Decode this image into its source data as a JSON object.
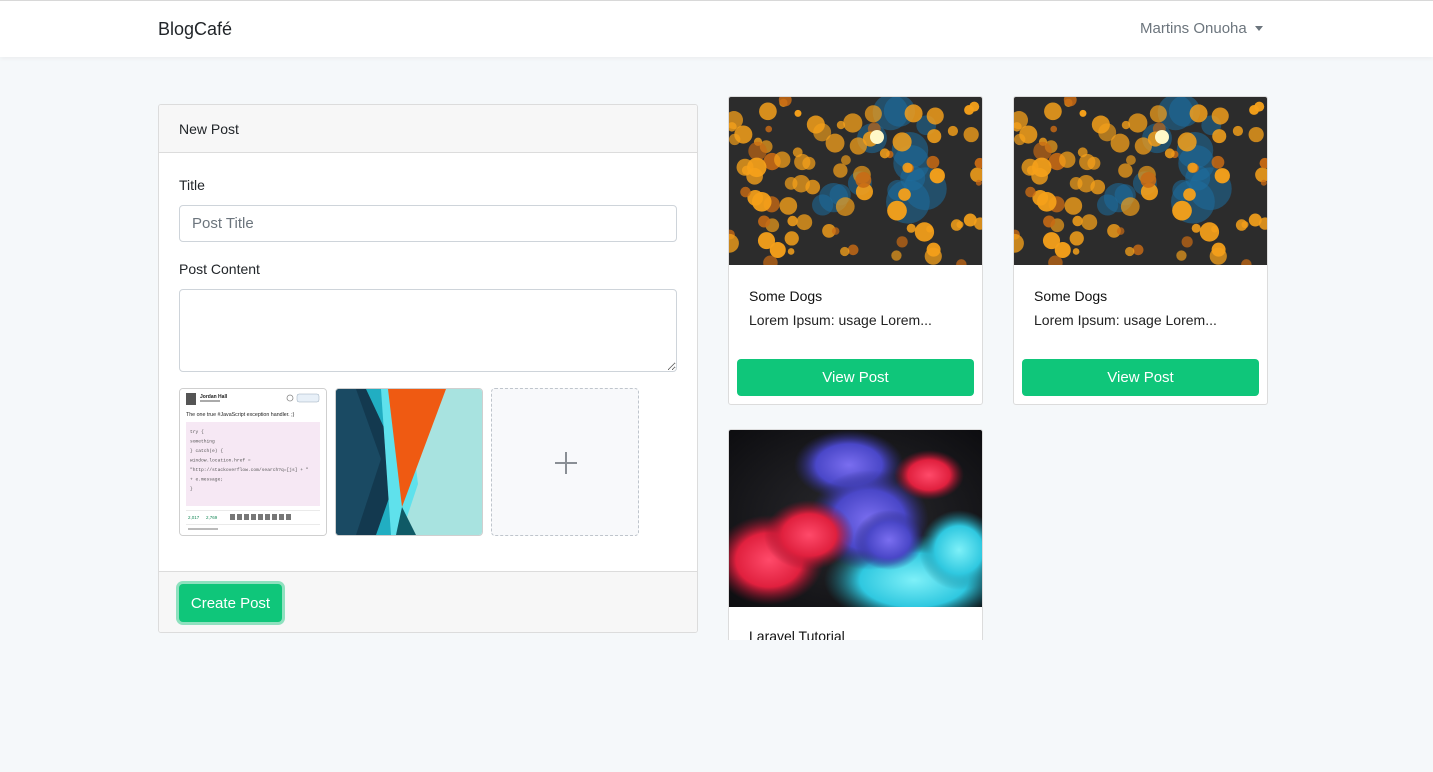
{
  "navbar": {
    "brand": "BlogCafé",
    "user_name": "Martins Onuoha"
  },
  "new_post": {
    "header": "New Post",
    "title_label": "Title",
    "title_placeholder": "Post Title",
    "title_value": "",
    "content_label": "Post Content",
    "content_value": "",
    "tweet_thumb": {
      "author": "Jordan Hall",
      "text": "The one true #JavaScript exception handler. ;)",
      "code": [
        "try {",
        "  something",
        "} catch(e) {",
        "  window.location.href =",
        "    \"http://stackoverflow.com/search?q=[js] + \"",
        "    + e.message;",
        "}"
      ]
    },
    "create_button": "Create Post"
  },
  "posts": [
    {
      "title": "Some Dogs",
      "excerpt": "Lorem Ipsum: usage Lorem...",
      "button": "View Post",
      "image": "bokeh-lights"
    },
    {
      "title": "Some Dogs",
      "excerpt": "Lorem Ipsum: usage Lorem...",
      "button": "View Post",
      "image": "bokeh-lights"
    },
    {
      "title": "Laravel Tutorial",
      "image": "color-smoke"
    }
  ],
  "colors": {
    "accent": "#0fc67a",
    "background": "#f5f8fa"
  }
}
